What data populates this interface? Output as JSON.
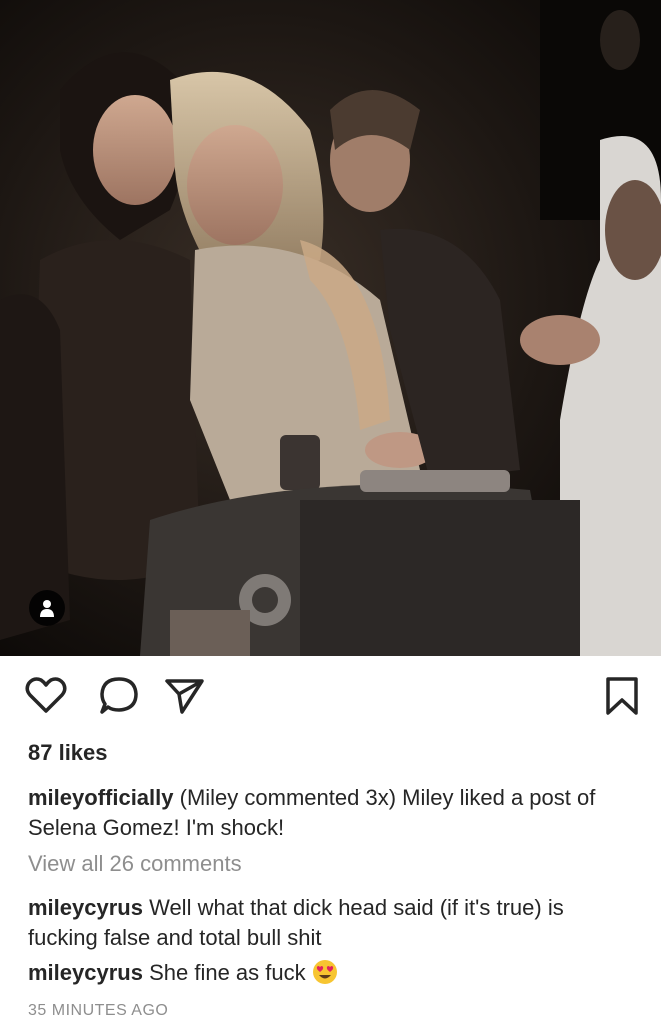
{
  "post": {
    "likes": "87 likes",
    "caption": {
      "username": "mileyofficially",
      "text": " (Miley commented 3x)  Miley liked a post of Selena Gomez! I'm shock!"
    },
    "view_all": "View all 26 comments",
    "comments": [
      {
        "username": "mileycyrus",
        "text": " Well what that dick head said (if it's true) is fucking false and total bull shit"
      },
      {
        "username": "mileycyrus",
        "text": " She  fine as fuck"
      }
    ],
    "timestamp": "35 MINUTES AGO"
  },
  "icons": {
    "like": "heart-icon",
    "comment": "comment-bubble-icon",
    "share": "paper-plane-icon",
    "save": "bookmark-icon",
    "tag": "user-tag-icon",
    "emoji": "heart-eyes-emoji"
  },
  "colors": {
    "text": "#262626",
    "muted": "#8e8e8e",
    "emoji": "#f7c531"
  }
}
